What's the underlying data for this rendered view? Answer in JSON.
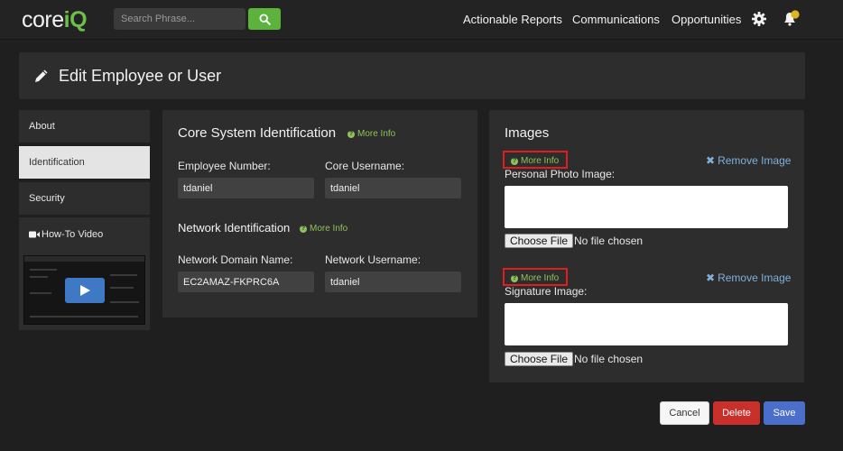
{
  "topbar": {
    "logo_core": "core",
    "logo_iq": "iQ",
    "search_placeholder": "Search Phrase...",
    "nav": [
      "Actionable Reports",
      "Communications",
      "Opportunities"
    ]
  },
  "page": {
    "title": "Edit Employee or User"
  },
  "sidebar": {
    "items": [
      {
        "label": "About",
        "active": false
      },
      {
        "label": "Identification",
        "active": true
      },
      {
        "label": "Security",
        "active": false
      }
    ],
    "video_label": "How-To Video"
  },
  "identification": {
    "core_heading": "Core System Identification",
    "more_info": "More Info",
    "employee_number_label": "Employee Number:",
    "employee_number_value": "tdaniel",
    "core_username_label": "Core Username:",
    "core_username_value": "tdaniel",
    "network_heading": "Network Identification",
    "network_domain_label": "Network Domain Name:",
    "network_domain_value": "EC2AMAZ-FKPRC6A",
    "network_username_label": "Network Username:",
    "network_username_value": "tdaniel"
  },
  "images": {
    "heading": "Images",
    "more_info": "More Info",
    "remove_image": "Remove Image",
    "personal_photo_label": "Personal Photo Image:",
    "signature_label": "Signature Image:",
    "choose_file": "Choose File",
    "no_file": "No file chosen"
  },
  "actions": {
    "cancel": "Cancel",
    "delete": "Delete",
    "save": "Save"
  },
  "colors": {
    "accent_green": "#6cc04a",
    "delete_red": "#c9302c",
    "save_blue": "#4a6ec9",
    "highlight_red": "#e01e1e"
  }
}
